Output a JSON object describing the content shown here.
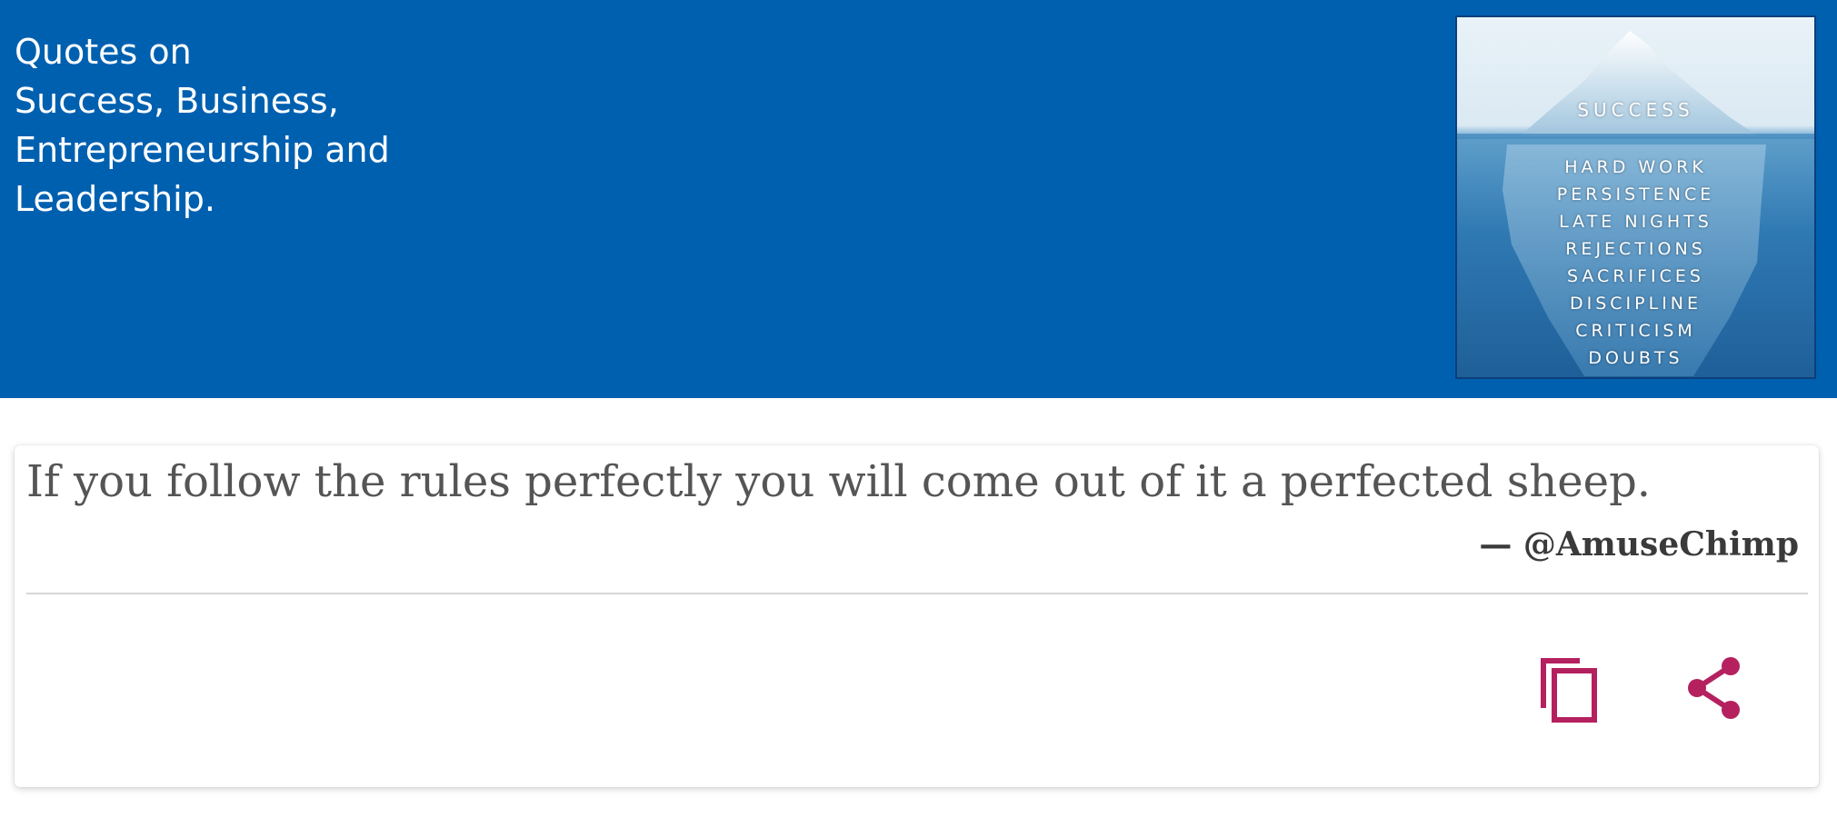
{
  "header": {
    "title_lines": [
      "Quotes on",
      "Success, Business,",
      "Entrepreneurship and",
      "Leadership."
    ],
    "poster": {
      "heading": "SUCCESS",
      "items": [
        "HARD WORK",
        "PERSISTENCE",
        "LATE NIGHTS",
        "REJECTIONS",
        "SACRIFICES",
        "DISCIPLINE",
        "CRITICISM",
        "DOUBTS"
      ]
    }
  },
  "quote_card": {
    "text": "If you follow the rules perfectly you will come out of it a perfected sheep.",
    "author": "— @AmuseChimp",
    "actions": {
      "copy_icon": "copy-icon",
      "share_icon": "share-icon"
    }
  },
  "colors": {
    "header_background": "#0060b0",
    "accent": "#b5215f",
    "quote_text": "#555555"
  }
}
